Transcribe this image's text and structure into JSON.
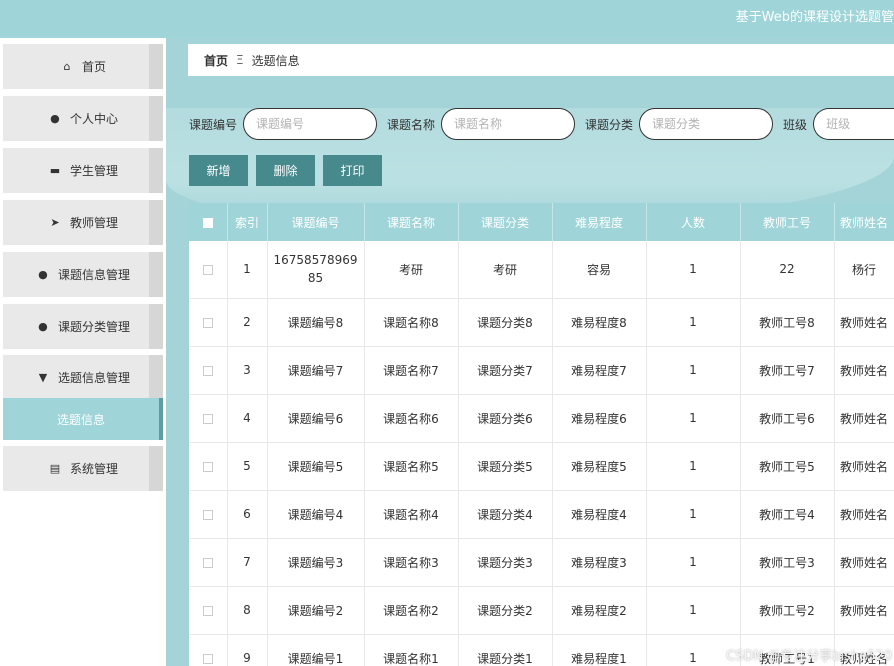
{
  "header": {
    "site_title": "基于Web的课程设计选题管"
  },
  "sidebar": {
    "items": [
      {
        "label": "首页",
        "icon": "home-icon",
        "glyph": "⌂"
      },
      {
        "label": "个人中心",
        "icon": "user-icon",
        "glyph": "●"
      },
      {
        "label": "学生管理",
        "icon": "monitor-icon",
        "glyph": "▬"
      },
      {
        "label": "教师管理",
        "icon": "send-icon",
        "glyph": "➤"
      },
      {
        "label": "课题信息管理",
        "icon": "user-icon",
        "glyph": "●"
      },
      {
        "label": "课题分类管理",
        "icon": "user-icon",
        "glyph": "●"
      },
      {
        "label": "选题信息管理",
        "icon": "pin-icon",
        "glyph": "▼"
      },
      {
        "label": "系统管理",
        "icon": "clipboard-icon",
        "glyph": "▤"
      }
    ],
    "active_sub": "选题信息"
  },
  "breadcrumb": {
    "home": "首页",
    "separator": "Ξ",
    "current": "选题信息"
  },
  "search": {
    "fields": [
      {
        "label": "课题编号",
        "placeholder": "课题编号"
      },
      {
        "label": "课题名称",
        "placeholder": "课题名称"
      },
      {
        "label": "课题分类",
        "placeholder": "课题分类"
      },
      {
        "label": "班级",
        "placeholder": "班级"
      }
    ]
  },
  "toolbar": {
    "add": "新增",
    "delete": "删除",
    "print": "打印"
  },
  "table": {
    "columns": [
      "索引",
      "课题编号",
      "课题名称",
      "课题分类",
      "难易程度",
      "人数",
      "教师工号",
      "教师姓名"
    ],
    "rows": [
      [
        "1",
        "1675857896985",
        "考研",
        "考研",
        "容易",
        "1",
        "22",
        "杨行"
      ],
      [
        "2",
        "课题编号8",
        "课题名称8",
        "课题分类8",
        "难易程度8",
        "1",
        "教师工号8",
        "教师姓名"
      ],
      [
        "3",
        "课题编号7",
        "课题名称7",
        "课题分类7",
        "难易程度7",
        "1",
        "教师工号7",
        "教师姓名"
      ],
      [
        "4",
        "课题编号6",
        "课题名称6",
        "课题分类6",
        "难易程度6",
        "1",
        "教师工号6",
        "教师姓名"
      ],
      [
        "5",
        "课题编号5",
        "课题名称5",
        "课题分类5",
        "难易程度5",
        "1",
        "教师工号5",
        "教师姓名"
      ],
      [
        "6",
        "课题编号4",
        "课题名称4",
        "课题分类4",
        "难易程度4",
        "1",
        "教师工号4",
        "教师姓名"
      ],
      [
        "7",
        "课题编号3",
        "课题名称3",
        "课题分类3",
        "难易程度3",
        "1",
        "教师工号3",
        "教师姓名"
      ],
      [
        "8",
        "课题编号2",
        "课题名称2",
        "课题分类2",
        "难易程度2",
        "1",
        "教师工号2",
        "教师姓名"
      ],
      [
        "9",
        "课题编号1",
        "课题名称1",
        "课题分类1",
        "难易程度1",
        "1",
        "教师工号1",
        "教师姓名"
      ]
    ]
  },
  "watermark": "CSDN @专注分享bishe520",
  "colors": {
    "accent": "#9fd4d8",
    "button": "#478a8e",
    "sidebar_active": "#9fd4d8"
  }
}
